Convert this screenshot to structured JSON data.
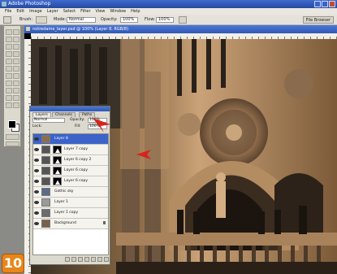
{
  "window": {
    "title": "Adobe Photoshop"
  },
  "menu": [
    "File",
    "Edit",
    "Image",
    "Layer",
    "Select",
    "Filter",
    "View",
    "Window",
    "Help"
  ],
  "options_bar": {
    "brush_label": "Brush:",
    "mode_label": "Mode:",
    "mode_value": "Normal",
    "opacity_label": "Opacity:",
    "opacity_value": "100%",
    "flow_label": "Flow:",
    "flow_value": "100%",
    "palette_button": "File Browser"
  },
  "document": {
    "title": "notredame_layer.psd @ 100% (Layer 8, RGB/8)"
  },
  "layers_panel": {
    "tabs": [
      "Layers",
      "Channels",
      "Paths"
    ],
    "blend_mode": "Normal",
    "opacity_label": "Opacity:",
    "opacity_value": "100%",
    "lock_label": "Lock:",
    "fill_label": "Fill:",
    "fill_value": "100%",
    "layers": [
      {
        "name": "Layer 8",
        "selected": true,
        "mask": false
      },
      {
        "name": "Layer 7 copy",
        "selected": false,
        "mask": true
      },
      {
        "name": "Layer 6 copy 2",
        "selected": false,
        "mask": true
      },
      {
        "name": "Layer 6 copy",
        "selected": false,
        "mask": true
      },
      {
        "name": "Layer 6 copy",
        "selected": false,
        "mask": true
      },
      {
        "name": "Gothic sky",
        "selected": false,
        "mask": false
      },
      {
        "name": "Layer 1",
        "selected": false,
        "mask": false
      },
      {
        "name": "Layer 1 copy",
        "selected": false,
        "mask": false
      },
      {
        "name": "Background",
        "selected": false,
        "mask": false,
        "locked": true
      }
    ]
  },
  "step_badge": "10",
  "colors": {
    "accent": "#e7861a",
    "arrow": "#d6231b",
    "selection": "#3b63c9"
  }
}
